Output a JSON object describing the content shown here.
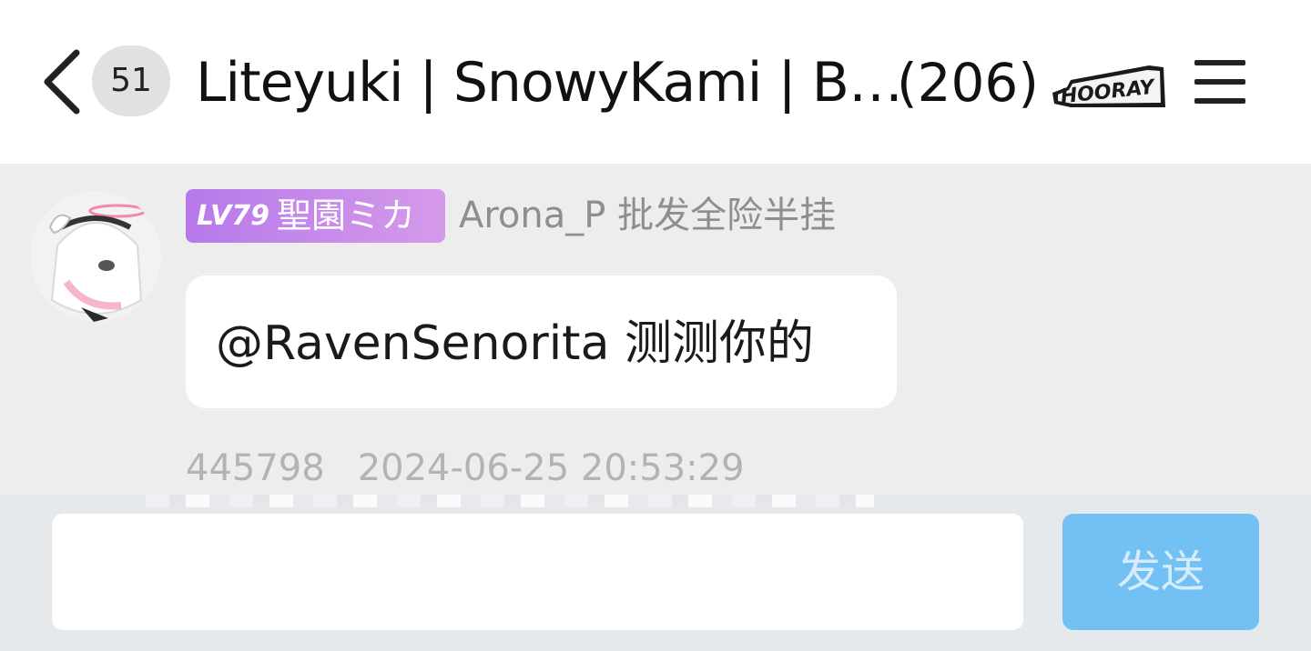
{
  "header": {
    "unread_count": "51",
    "title": "Liteyuki | SnowyKami | B…",
    "member_count": "(206)",
    "emblem_icon": "hooray-group-emblem-icon",
    "emblem_text": "HOORAY",
    "back_icon": "chevron-left-icon",
    "menu_icon": "hamburger-menu-icon"
  },
  "message": {
    "level_tag": "LV79",
    "level_title": "聖園ミカ",
    "sender": "Arona_P 批发全险半挂",
    "text": "@RavenSenorita 测测你的",
    "id": "445798",
    "timestamp": "2024-06-25 20:53:29"
  },
  "input": {
    "value": "",
    "send_label": "发送"
  },
  "colors": {
    "level_gradient_start": "#b779ea",
    "level_gradient_end": "#d59aea",
    "send_button": "#73c1f4",
    "chat_background": "#ededed"
  }
}
